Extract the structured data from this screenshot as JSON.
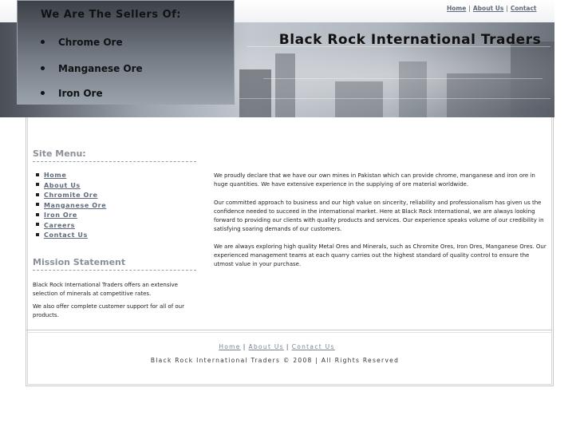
{
  "header": {
    "site_title": "Black Rock International Traders",
    "top_nav": [
      {
        "label": "Home"
      },
      {
        "label": "About Us"
      },
      {
        "label": "Contact"
      }
    ],
    "sellers_box": {
      "title": "We Are The Sellers Of:",
      "items": [
        "Chrome Ore",
        "Manganese Ore",
        "Iron Ore"
      ]
    }
  },
  "sidebar": {
    "menu_heading": "Site Menu:",
    "menu_items": [
      "Home",
      "About Us",
      "Chromite Ore",
      "Manganese Ore",
      "Iron Ore",
      "Careers",
      "Contact Us"
    ],
    "mission_heading": "Mission Statement",
    "mission_paragraphs": [
      "Black Rock International Traders offers an extensive selection of minerals at competitive rates.",
      "We also offer complete customer support for all of our products."
    ]
  },
  "main": {
    "paragraphs": [
      "We proudly declare that we have our own mines in Pakistan which can provide chrome, manganese and iron ore in huge quantities. We have extensive experience in the supplying of ore material worldwide.",
      "Our committed approach to business and our high value on sincerity, reliability and professionalism has given us the confidence needed to succeed in the international market. Here at Black Rock International, we are always looking forward to providing our clients with quality products and services. Our experience speaks volume of our credibility in satisfying soaring demands of our customers.",
      "We are always exploring high quality Metal Ores and Minerals, such as Chromite Ores, Iron Ores, Manganese Ores. Our experienced management teams at each quarry carries out the highest standard of quality control to ensure the utmost value in your purchase."
    ]
  },
  "footer": {
    "nav": [
      {
        "label": "Home"
      },
      {
        "label": "About Us"
      },
      {
        "label": "Contact Us"
      }
    ],
    "copyright": "Black Rock International Traders © 2008 | All Rights Reserved"
  }
}
